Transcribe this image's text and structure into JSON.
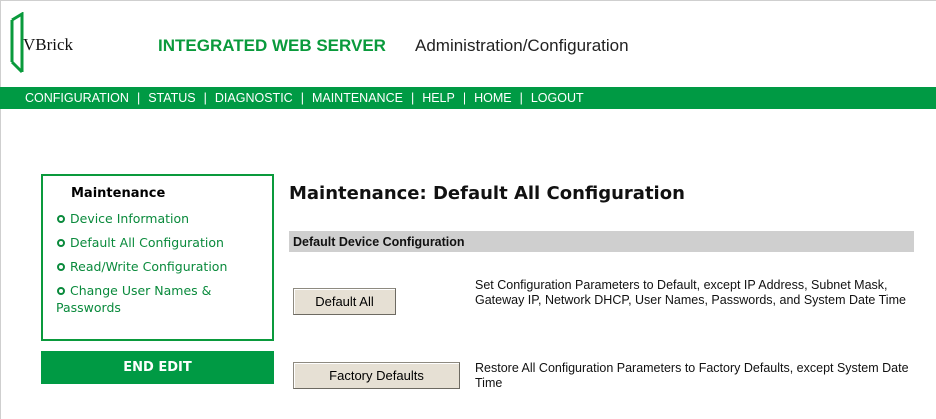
{
  "header": {
    "logo_text": "VBrick",
    "title": "INTEGRATED WEB SERVER",
    "subtitle": "Administration/Configuration"
  },
  "nav": {
    "items": [
      "CONFIGURATION",
      "STATUS",
      "DIAGNOSTIC",
      "MAINTENANCE",
      "HELP",
      "HOME",
      "LOGOUT"
    ],
    "separator": "|"
  },
  "sidebar": {
    "title": "Maintenance",
    "links": [
      {
        "label": "Device Information"
      },
      {
        "label": "Default All Configuration"
      },
      {
        "label": "Read/Write Configuration"
      },
      {
        "label": "Change User Names &",
        "label_cont": "Passwords"
      }
    ],
    "end_edit_label": "END EDIT"
  },
  "main": {
    "title": "Maintenance: Default All Configuration",
    "section_header": "Default Device Configuration",
    "actions": [
      {
        "button_label": "Default All",
        "description": "Set Configuration Parameters to Default, except IP Address, Subnet Mask, Gateway IP, Network DHCP, User Names, Passwords, and System Date Time"
      },
      {
        "button_label": "Factory Defaults",
        "description": "Restore All Configuration Parameters to Factory Defaults, except System Date Time"
      }
    ]
  },
  "colors": {
    "brand_green": "#009a44",
    "link_green": "#0a8a3c",
    "section_gray": "#cfcfcf"
  }
}
